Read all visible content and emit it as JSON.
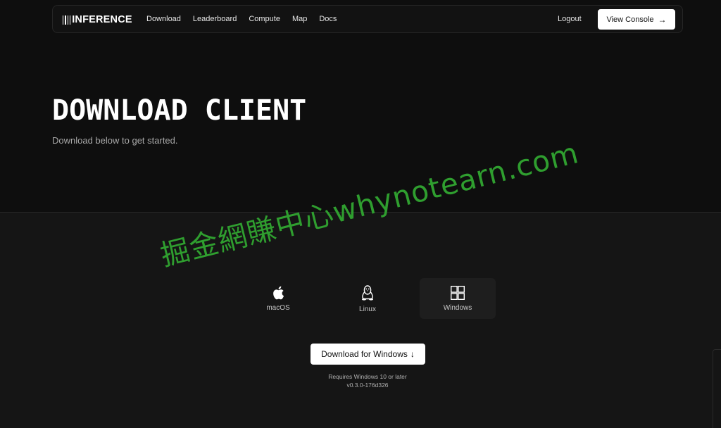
{
  "nav": {
    "logo_text": "INFERENCE",
    "links": [
      "Download",
      "Leaderboard",
      "Compute",
      "Map",
      "Docs"
    ],
    "logout": "Logout",
    "console_button": "View Console"
  },
  "hero": {
    "title": "DOWNLOAD CLIENT",
    "subtitle": "Download below to get started."
  },
  "platforms": [
    {
      "label": "macOS",
      "icon": "apple-icon",
      "active": false
    },
    {
      "label": "Linux",
      "icon": "linux-tux-icon",
      "active": false
    },
    {
      "label": "Windows",
      "icon": "windows-icon",
      "active": true
    }
  ],
  "download": {
    "button_label": "Download for Windows",
    "requirement": "Requires Windows 10 or later",
    "version": "v0.3.0-176d326"
  },
  "watermark": "掘金網賺中心whynotearn.com",
  "colors": {
    "background": "#0e0e0e",
    "section_bg": "#151515",
    "button_bg": "#ffffff",
    "watermark": "#2f9e2f"
  }
}
